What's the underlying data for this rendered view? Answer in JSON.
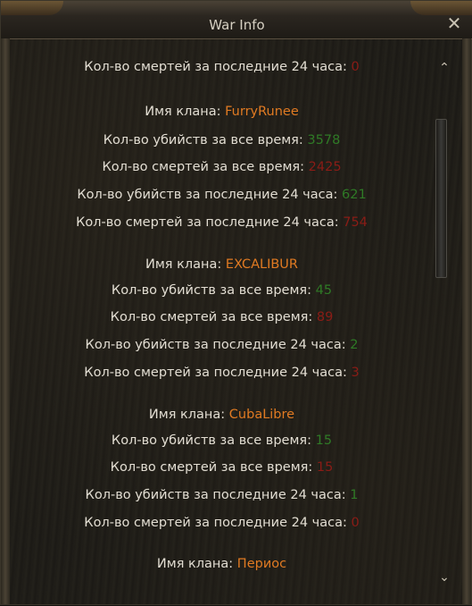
{
  "window": {
    "title": "War Info",
    "close_glyph": "✕"
  },
  "colors": {
    "text": "#e2ddd2",
    "positive": "#2f7a26",
    "negative": "#8a1c16",
    "clan_name": "#e07a22"
  },
  "entries": [
    {
      "label": "Кол-во смертей за последние 24 часа:",
      "value": "0"
    },
    {
      "label": "Имя клана:",
      "value": "FurryRunee"
    },
    {
      "label": "Кол-во убийств за все время:",
      "value": "3578"
    },
    {
      "label": "Кол-во смертей за все время:",
      "value": "2425"
    },
    {
      "label": "Кол-во убийств за последние 24 часа:",
      "value": "621"
    },
    {
      "label": "Кол-во смертей за последние 24 часа:",
      "value": "754"
    },
    {
      "label": "Имя клана:",
      "value": "EXCALIBUR"
    },
    {
      "label": "Кол-во убийств за все время:",
      "value": "45"
    },
    {
      "label": "Кол-во смертей за все время:",
      "value": "89"
    },
    {
      "label": "Кол-во убийств за последние 24 часа:",
      "value": "2"
    },
    {
      "label": "Кол-во смертей за последние 24 часа:",
      "value": "3"
    },
    {
      "label": "Имя клана:",
      "value": "CubaLibre"
    },
    {
      "label": "Кол-во убийств за все время:",
      "value": "15"
    },
    {
      "label": "Кол-во смертей за все время:",
      "value": "15"
    },
    {
      "label": "Кол-во убийств за последние 24 часа:",
      "value": "1"
    },
    {
      "label": "Кол-во смертей за последние 24 часа:",
      "value": "0"
    },
    {
      "label": "Имя клана:",
      "value": "Периос"
    }
  ],
  "scrollbar": {
    "up_glyph": "⌃",
    "down_glyph": "⌄",
    "position_fraction": 0.0
  }
}
